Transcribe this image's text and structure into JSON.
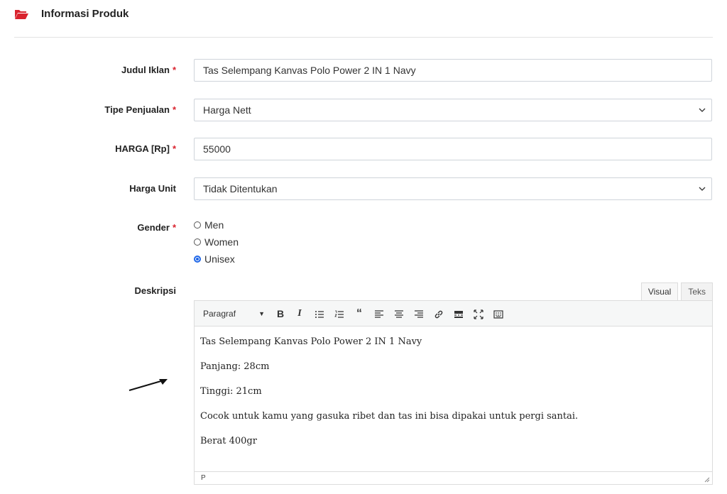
{
  "header": {
    "title": "Informasi Produk",
    "icon": "folder-open-icon",
    "icon_color": "#d9232e"
  },
  "required_mark": "*",
  "form": {
    "judul": {
      "label": "Judul Iklan",
      "value": "Tas Selempang Kanvas Polo Power 2 IN 1 Navy"
    },
    "tipe": {
      "label": "Tipe Penjualan",
      "value": "Harga Nett"
    },
    "harga": {
      "label": "HARGA [Rp]",
      "value": "55000"
    },
    "harga_unit": {
      "label": "Harga Unit",
      "value": "Tidak Ditentukan"
    },
    "gender": {
      "label": "Gender",
      "options": [
        "Men",
        "Women",
        "Unisex"
      ],
      "selected": "Unisex"
    },
    "deskripsi": {
      "label": "Deskripsi",
      "tabs": [
        "Visual",
        "Teks"
      ],
      "active_tab": "Visual",
      "format": "Paragraf",
      "toolbar": [
        "bold-icon",
        "italic-icon",
        "bullet-list-icon",
        "numbered-list-icon",
        "blockquote-icon",
        "align-left-icon",
        "align-center-icon",
        "align-right-icon",
        "link-icon",
        "read-more-icon",
        "fullscreen-icon",
        "toolbar-toggle-icon"
      ],
      "lines": [
        "Tas Selempang Kanvas Polo Power 2 IN 1 Navy",
        "Panjang: 28cm",
        "Tinggi: 21cm",
        "Cocok untuk kamu yang gasuka ribet dan tas ini bisa dipakai untuk pergi santai.",
        "Berat 400gr"
      ],
      "path": "P"
    }
  },
  "colors": {
    "required": "#d9232e",
    "radio_selected": "#1e66e8",
    "border": "#cfd4da"
  }
}
